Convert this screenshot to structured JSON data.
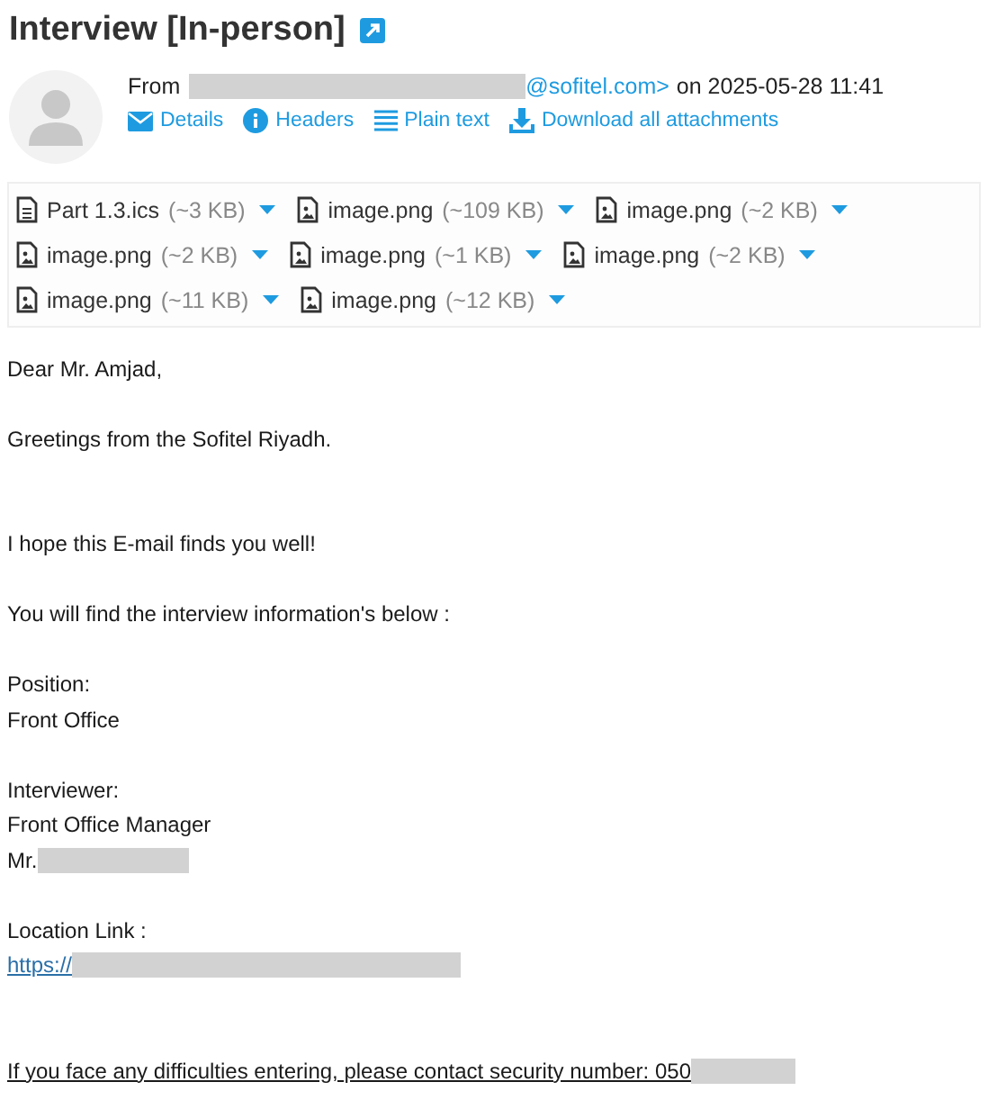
{
  "title": "Interview [In-person]",
  "from": {
    "label": "From",
    "address_tail": "@sofitel.com>",
    "date": "on 2025-05-28 11:41",
    "redacted": true
  },
  "actions": [
    {
      "kind": "details",
      "label": "Details"
    },
    {
      "kind": "headers",
      "label": "Headers"
    },
    {
      "kind": "plain",
      "label": "Plain text"
    },
    {
      "kind": "download",
      "label": "Download all attachments"
    }
  ],
  "attachment_rows": [
    [
      {
        "kind": "calendar",
        "name": "Part 1.3.ics",
        "size": "(~3 KB)"
      },
      {
        "kind": "image",
        "name": "image.png",
        "size": "(~109 KB)"
      },
      {
        "kind": "image",
        "name": "image.png",
        "size": "(~2 KB)"
      }
    ],
    [
      {
        "kind": "image",
        "name": "image.png",
        "size": "(~2 KB)"
      },
      {
        "kind": "image",
        "name": "image.png",
        "size": "(~1 KB)"
      },
      {
        "kind": "image",
        "name": "image.png",
        "size": "(~2 KB)"
      }
    ],
    [
      {
        "kind": "image",
        "name": "image.png",
        "size": "(~11 KB)"
      },
      {
        "kind": "image",
        "name": "image.png",
        "size": "(~12 KB)"
      }
    ]
  ],
  "body": [
    {
      "kind": "text",
      "text": "Dear Mr. Amjad,"
    },
    {
      "kind": "blank"
    },
    {
      "kind": "text",
      "text": "Greetings from the  Sofitel Riyadh."
    },
    {
      "kind": "blank"
    },
    {
      "kind": "blank"
    },
    {
      "kind": "text",
      "text": "I hope this E-mail finds you well!"
    },
    {
      "kind": "blank"
    },
    {
      "kind": "text",
      "text": "You will find the interview information's below :"
    },
    {
      "kind": "blank"
    },
    {
      "kind": "text",
      "text": "Position:"
    },
    {
      "kind": "text",
      "text": "Front Office"
    },
    {
      "kind": "blank"
    },
    {
      "kind": "text",
      "text": "Interviewer:"
    },
    {
      "kind": "text",
      "text": "Front Office Manager"
    },
    {
      "kind": "text",
      "text": "Mr.",
      "redacted": true
    },
    {
      "kind": "blank"
    },
    {
      "kind": "text",
      "text": "Location Link :"
    },
    {
      "kind": "link",
      "text": "https://",
      "redacted": true
    },
    {
      "kind": "blank"
    },
    {
      "kind": "blank"
    },
    {
      "kind": "underlined",
      "text": "If you face any difficulties entering, please contact security number: 050",
      "redacted": true
    }
  ]
}
